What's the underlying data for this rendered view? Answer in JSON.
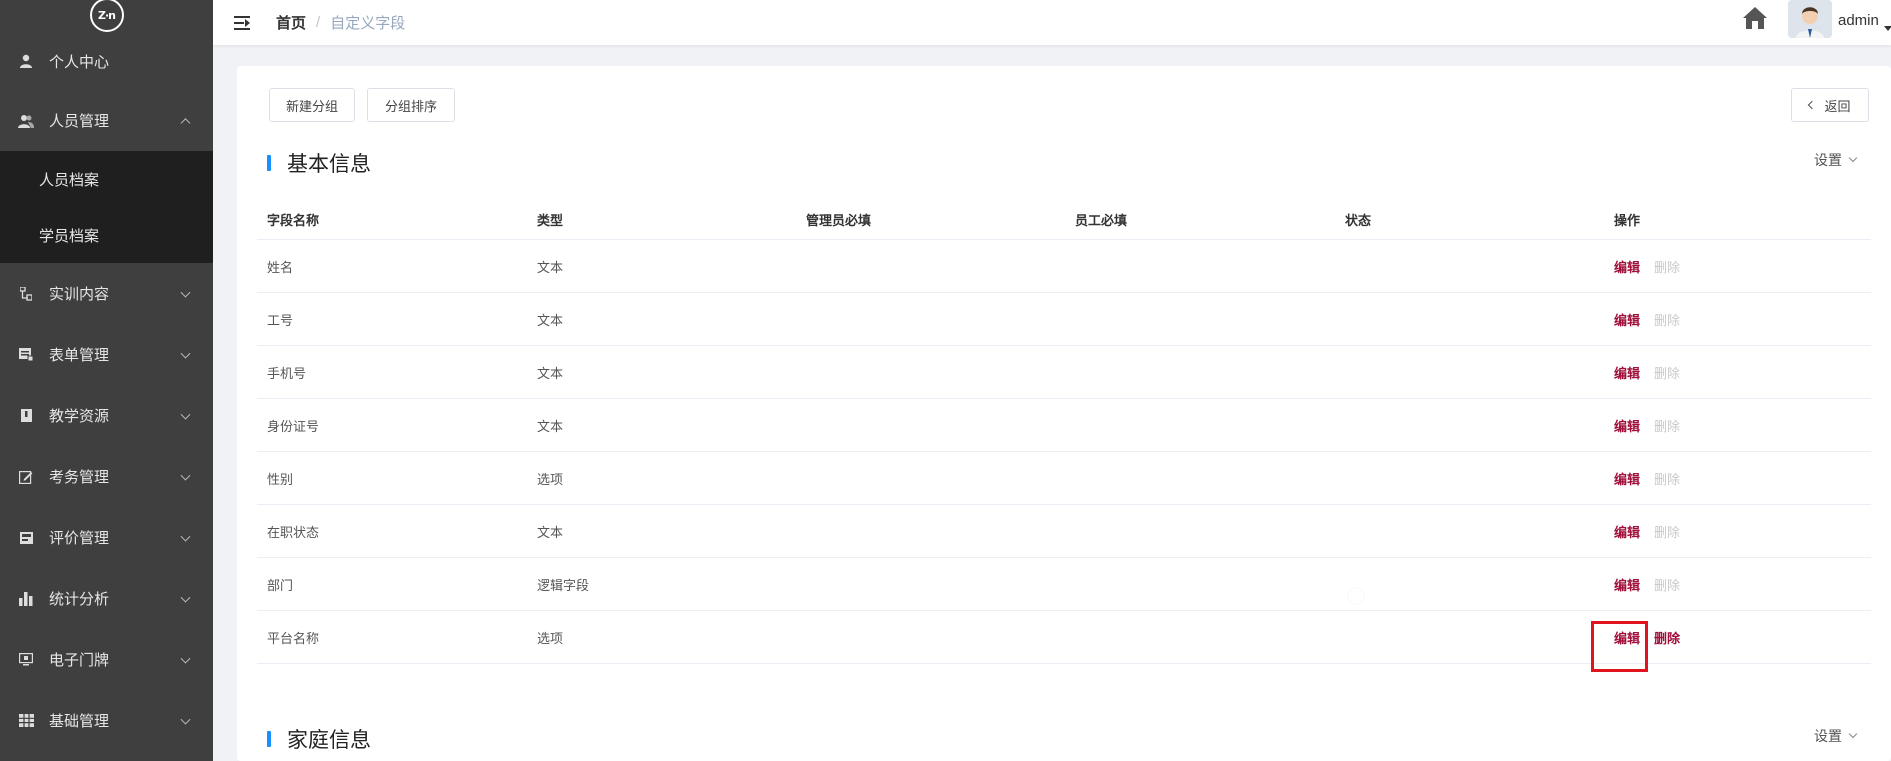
{
  "logo_text": "Z·n",
  "sidebar": {
    "items": [
      {
        "label": "个人中心",
        "icon": "user-icon"
      },
      {
        "label": "人员管理",
        "icon": "users-icon",
        "expanded": true,
        "children": [
          {
            "label": "人员档案"
          },
          {
            "label": "学员档案"
          }
        ]
      },
      {
        "label": "实训内容",
        "icon": "flow-icon"
      },
      {
        "label": "表单管理",
        "icon": "form-icon"
      },
      {
        "label": "教学资源",
        "icon": "book-icon"
      },
      {
        "label": "考务管理",
        "icon": "edit-icon"
      },
      {
        "label": "评价管理",
        "icon": "rating-icon"
      },
      {
        "label": "统计分析",
        "icon": "bar-chart-icon"
      },
      {
        "label": "电子门牌",
        "icon": "monitor-icon"
      },
      {
        "label": "基础管理",
        "icon": "grid-icon"
      }
    ]
  },
  "header": {
    "breadcrumb_home": "首页",
    "breadcrumb_sep": "/",
    "breadcrumb_current": "自定义字段",
    "username": "admin"
  },
  "toolbar": {
    "new_group": "新建分组",
    "group_sort": "分组排序",
    "back": "返回"
  },
  "sections": [
    {
      "title": "基本信息",
      "settings_label": "设置",
      "columns": [
        "字段名称",
        "类型",
        "管理员必填",
        "员工必填",
        "状态",
        "操作"
      ],
      "rows": [
        {
          "name": "姓名",
          "type": "文本",
          "enabled": true,
          "edit": "编辑",
          "delete": "删除",
          "delete_active": false
        },
        {
          "name": "工号",
          "type": "文本",
          "enabled": true,
          "edit": "编辑",
          "delete": "删除",
          "delete_active": false
        },
        {
          "name": "手机号",
          "type": "文本",
          "enabled": true,
          "edit": "编辑",
          "delete": "删除",
          "delete_active": false
        },
        {
          "name": "身份证号",
          "type": "文本",
          "enabled": true,
          "edit": "编辑",
          "delete": "删除",
          "delete_active": false
        },
        {
          "name": "性别",
          "type": "选项",
          "enabled": true,
          "edit": "编辑",
          "delete": "删除",
          "delete_active": false
        },
        {
          "name": "在职状态",
          "type": "文本",
          "enabled": true,
          "edit": "编辑",
          "delete": "删除",
          "delete_active": false
        },
        {
          "name": "部门",
          "type": "逻辑字段",
          "enabled": false,
          "edit": "编辑",
          "delete": "删除",
          "delete_active": false
        },
        {
          "name": "平台名称",
          "type": "选项",
          "enabled": true,
          "edit": "编辑",
          "delete": "删除",
          "delete_active": true
        }
      ]
    },
    {
      "title": "家庭信息",
      "settings_label": "设置"
    }
  ],
  "colors": {
    "sidebar_bg": "#3f3f3f",
    "submenu_bg": "#1f1f1f",
    "accent": "#a0103b",
    "section_bar": "#1890ff",
    "highlight": "#e0141f"
  }
}
